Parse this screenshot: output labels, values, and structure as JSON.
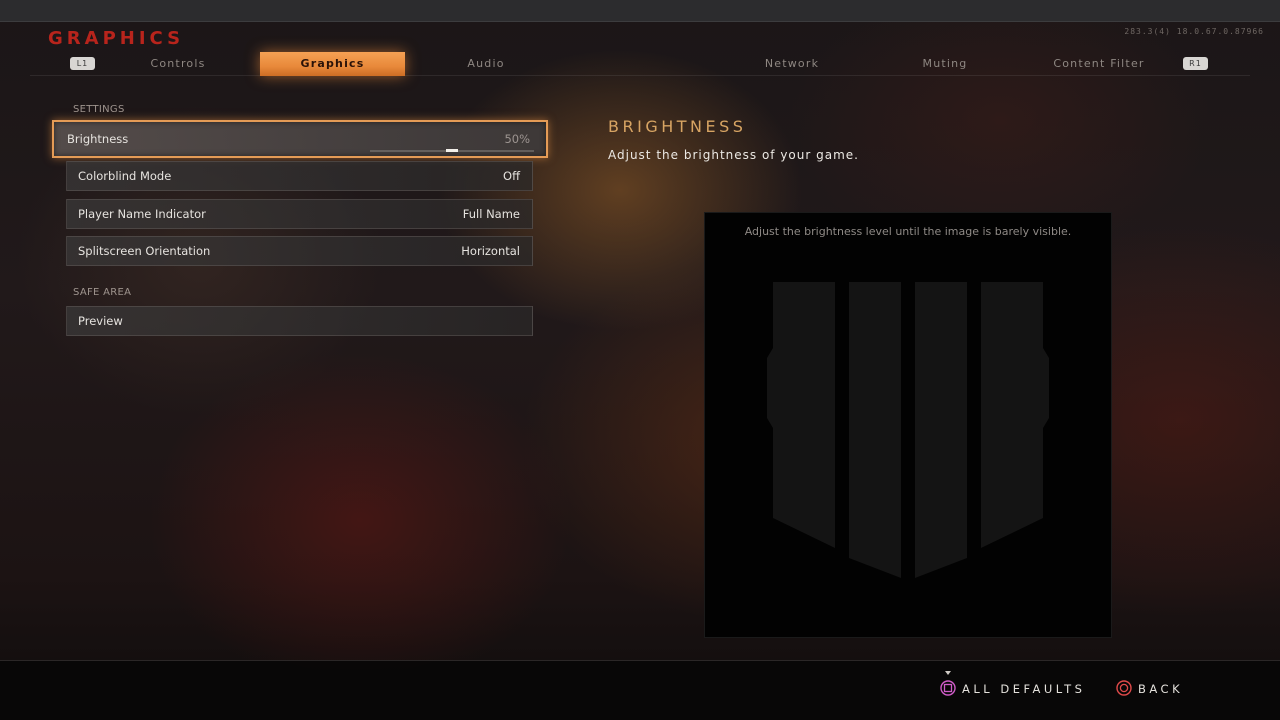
{
  "header": {
    "title": "GRAPHICS",
    "build_info": "283.3(4) 18.0.67.0.87966"
  },
  "tabs": {
    "left_bumper": "L1",
    "right_bumper": "R1",
    "items": [
      {
        "label": "Controls",
        "active": false
      },
      {
        "label": "Graphics",
        "active": true
      },
      {
        "label": "Audio",
        "active": false
      },
      {
        "label": "Network",
        "active": false
      },
      {
        "label": "Muting",
        "active": false
      },
      {
        "label": "Content Filter",
        "active": false
      }
    ]
  },
  "settings": {
    "section_label": "SETTINGS",
    "rows": [
      {
        "label": "Brightness",
        "value": "50%",
        "slider_fraction": 0.5
      },
      {
        "label": "Colorblind Mode",
        "value": "Off"
      },
      {
        "label": "Player Name Indicator",
        "value": "Full Name"
      },
      {
        "label": "Splitscreen Orientation",
        "value": "Horizontal"
      }
    ]
  },
  "safe_area": {
    "section_label": "SAFE AREA",
    "preview_label": "Preview"
  },
  "detail": {
    "title": "BRIGHTNESS",
    "description": "Adjust the brightness of your game.",
    "preview_instruction": "Adjust the brightness level until the image is barely visible."
  },
  "footer": {
    "all_defaults": "ALL DEFAULTS",
    "back": "BACK"
  },
  "colors": {
    "accent_orange": "#e8893a",
    "title_red": "#b8241c",
    "detail_title": "#d7a463",
    "square_button": "#d05cc8",
    "circle_button": "#e04a4a"
  }
}
